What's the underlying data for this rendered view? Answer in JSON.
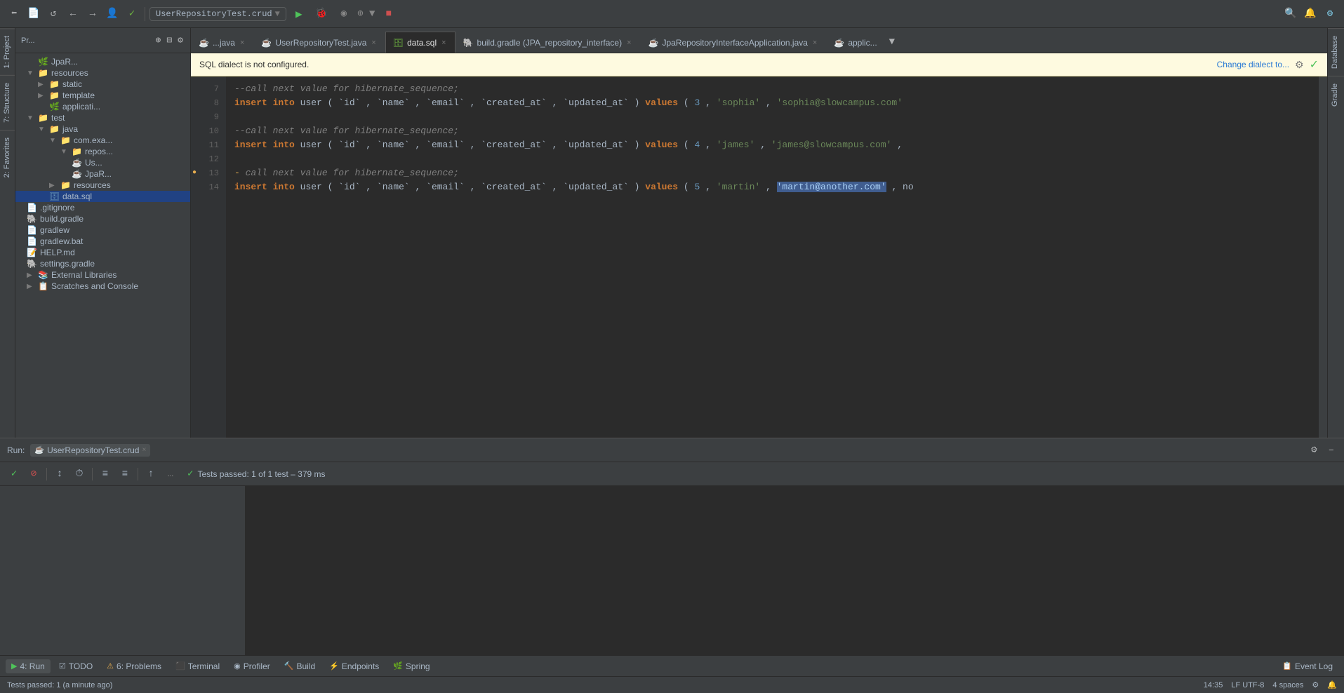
{
  "toolbar": {
    "run_config": "UserRepositoryTest.crud",
    "back_label": "←",
    "forward_label": "→"
  },
  "tabs": {
    "items": [
      {
        "label": "...java",
        "type": "java",
        "active": false,
        "closable": true
      },
      {
        "label": "UserRepositoryTest.java",
        "type": "java",
        "active": false,
        "closable": true
      },
      {
        "label": "data.sql",
        "type": "sql",
        "active": true,
        "closable": true
      },
      {
        "label": "build.gradle (JPA_repository_interface)",
        "type": "gradle",
        "active": false,
        "closable": true
      },
      {
        "label": "JpaRepositoryInterfaceApplication.java",
        "type": "java",
        "active": false,
        "closable": true
      },
      {
        "label": "applic...",
        "type": "java",
        "active": false,
        "closable": false
      }
    ],
    "overflow": "▼"
  },
  "dialect_warning": {
    "message": "SQL dialect is not configured.",
    "change_link": "Change dialect to...",
    "check_icon": "✓"
  },
  "code": {
    "lines": [
      {
        "num": "7",
        "content": "",
        "type": "comment",
        "text": "--call next value for hibernate_sequence;"
      },
      {
        "num": "8",
        "content": "",
        "type": "sql",
        "text": "insert into user (`id`, `name`, `email`, `created_at`, `updated_at`) values (3, 'sophia', 'sophia@slowcampus.com'"
      },
      {
        "num": "9",
        "content": "",
        "type": "empty",
        "text": ""
      },
      {
        "num": "10",
        "content": "",
        "type": "comment",
        "text": "--call next value for hibernate_sequence;"
      },
      {
        "num": "11",
        "content": "",
        "type": "sql",
        "text": "insert into user (`id`, `name`, `email`, `created_at`, `updated_at`) values (4, 'james', 'james@slowcampus.com',"
      },
      {
        "num": "12",
        "content": "",
        "type": "empty",
        "text": ""
      },
      {
        "num": "13",
        "content": "",
        "type": "comment_indicator",
        "text": "-call next value for hibernate_sequence;"
      },
      {
        "num": "14",
        "content": "",
        "type": "sql_highlight",
        "text": "insert into user (`id`, `name`, `email`, `created_at`, `updated_at`) values (5, 'martin', 'martin@another.com', no"
      }
    ]
  },
  "project_tree": {
    "title": "Pr...",
    "items": [
      {
        "label": "resources",
        "type": "folder",
        "depth": 1,
        "expanded": true
      },
      {
        "label": "static",
        "type": "folder",
        "depth": 2,
        "expanded": false
      },
      {
        "label": "template",
        "type": "folder",
        "depth": 2,
        "expanded": false
      },
      {
        "label": "applicati...",
        "type": "spring",
        "depth": 2,
        "expanded": false
      },
      {
        "label": "test",
        "type": "folder",
        "depth": 1,
        "expanded": true
      },
      {
        "label": "java",
        "type": "folder",
        "depth": 2,
        "expanded": true
      },
      {
        "label": "com.exa...",
        "type": "folder",
        "depth": 3,
        "expanded": true
      },
      {
        "label": "repos...",
        "type": "folder",
        "depth": 4,
        "expanded": true
      },
      {
        "label": "Us...",
        "type": "java",
        "depth": 5,
        "expanded": false
      },
      {
        "label": "JpaR...",
        "type": "java",
        "depth": 4,
        "expanded": false
      },
      {
        "label": "resources",
        "type": "folder",
        "depth": 3,
        "expanded": false
      },
      {
        "label": "data.sql",
        "type": "sql",
        "depth": 2,
        "expanded": false,
        "selected": true
      },
      {
        "label": ".gitignore",
        "type": "file",
        "depth": 1,
        "expanded": false
      },
      {
        "label": "build.gradle",
        "type": "gradle",
        "depth": 1,
        "expanded": false
      },
      {
        "label": "gradlew",
        "type": "file",
        "depth": 1,
        "expanded": false
      },
      {
        "label": "gradlew.bat",
        "type": "file",
        "depth": 1,
        "expanded": false
      },
      {
        "label": "HELP.md",
        "type": "md",
        "depth": 1,
        "expanded": false
      },
      {
        "label": "settings.gradle",
        "type": "gradle",
        "depth": 1,
        "expanded": false
      },
      {
        "label": "External Libraries",
        "type": "library",
        "depth": 1,
        "expanded": false
      },
      {
        "label": "Scratches and Console",
        "type": "scratches",
        "depth": 1,
        "expanded": false
      }
    ]
  },
  "run_panel": {
    "label": "Run:",
    "tab": "UserRepositoryTest.crud",
    "test_result": "Tests passed: 1 of 1 test – 379 ms",
    "status": "Tests passed: 1 (a minute ago)"
  },
  "bottom_tabs": [
    {
      "label": "4: Run",
      "icon": "▶",
      "active": true
    },
    {
      "label": "TODO",
      "icon": "☑",
      "active": false
    },
    {
      "label": "6: Problems",
      "icon": "⚠",
      "active": false
    },
    {
      "label": "Terminal",
      "icon": "⬛",
      "active": false
    },
    {
      "label": "Profiler",
      "icon": "◉",
      "active": false
    },
    {
      "label": "Build",
      "icon": "🔨",
      "active": false
    },
    {
      "label": "Endpoints",
      "icon": "⚡",
      "active": false
    },
    {
      "label": "Spring",
      "icon": "🌿",
      "active": false
    },
    {
      "label": "Event Log",
      "icon": "📋",
      "active": false
    }
  ],
  "status_bar": {
    "left": "Tests passed: 1 (a minute ago)",
    "time": "14:35",
    "encoding": "LF  UTF-8",
    "indent": "4 spaces"
  },
  "side_panels": {
    "right": [
      "Database",
      "Gradle"
    ],
    "left": [
      "1: Project",
      "7: Structure",
      "2: Favorites"
    ]
  }
}
